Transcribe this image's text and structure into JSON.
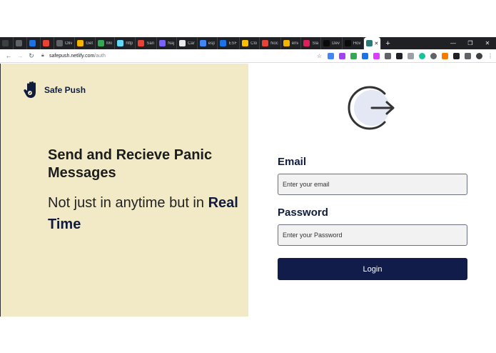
{
  "browser": {
    "tabs": [
      {
        "label": "",
        "icon": "app-icon",
        "color": "#3c4043"
      },
      {
        "label": "",
        "icon": "circle-icon",
        "color": "#5f6368"
      },
      {
        "label": "",
        "icon": "square-icon",
        "color": "#1a73e8"
      },
      {
        "label": "",
        "icon": "record-icon",
        "color": "#ea4335"
      },
      {
        "label": "Oliv",
        "icon": "github-icon",
        "color": "#5f6368"
      },
      {
        "label": "Get",
        "icon": "hand-icon",
        "color": "#f4b400"
      },
      {
        "label": "Mo",
        "icon": "sheet-icon",
        "color": "#34a853"
      },
      {
        "label": "http",
        "icon": "react-icon",
        "color": "#61dafb"
      },
      {
        "label": "San",
        "icon": "mail-icon",
        "color": "#ea4335"
      },
      {
        "label": "Naj",
        "icon": "bars-icon",
        "color": "#7b61ff"
      },
      {
        "label": "Car",
        "icon": "doc-icon",
        "color": "#e8eaed"
      },
      {
        "label": "esp",
        "icon": "google-icon",
        "color": "#4285f4"
      },
      {
        "label": "ESF",
        "icon": "r-icon",
        "color": "#1a73e8"
      },
      {
        "label": "Clo",
        "icon": "cloud-icon",
        "color": "#fbbc04"
      },
      {
        "label": "Noc",
        "icon": "chevrons-icon",
        "color": "#ea4335"
      },
      {
        "label": "env",
        "icon": "hand-icon",
        "color": "#f4b400"
      },
      {
        "label": "Sla",
        "icon": "slack-icon",
        "color": "#e01e5a"
      },
      {
        "label": "Dev",
        "icon": "d-icon",
        "color": "#0a0a0a"
      },
      {
        "label": "Hov",
        "icon": "d-icon",
        "color": "#0a0a0a"
      }
    ],
    "active_tab_icon_color": "#2b7a78",
    "new_tab": "+",
    "window_controls": [
      "—",
      "❐",
      "✕"
    ],
    "url_host": "safepush.netlify.com",
    "url_path": "/auth"
  },
  "brand": {
    "name": "Safe Push"
  },
  "hero": {
    "headline": "Send and Recieve Panic Messages",
    "sub_prefix": "Not just in anytime but in ",
    "sub_emphasis": "Real Time"
  },
  "form": {
    "email_label": "Email",
    "email_placeholder": "Enter your email",
    "password_label": "Password",
    "password_placeholder": "Enter your Password",
    "login_label": "Login"
  },
  "colors": {
    "accent": "#111c4a",
    "hero_background": "#f2eac7"
  }
}
